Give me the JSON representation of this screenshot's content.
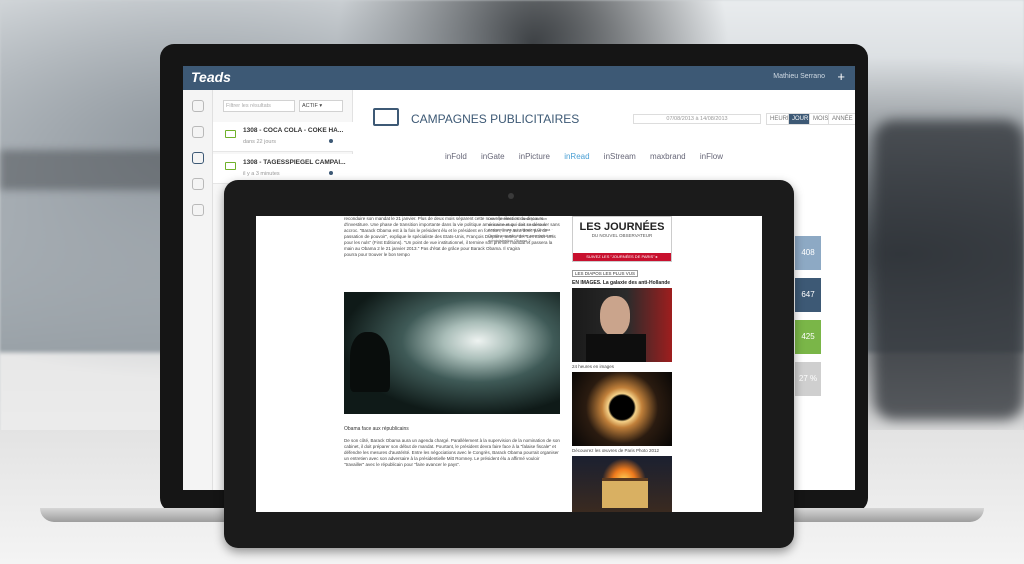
{
  "app": {
    "logo": "Teads",
    "user_name": "Mathieu Serrano",
    "add_symbol": "+"
  },
  "sidebar": {
    "search_placeholder": "Filtrer les résultats",
    "status_filter": "ACTIF ▾",
    "items": [
      {
        "title": "1308 - COCA COLA - COKE HA...",
        "subtitle": "dans 22 jours"
      },
      {
        "title": "1308 - TAGESSPIEGEL CAMPAI...",
        "subtitle": "il y a 3 minutes"
      }
    ]
  },
  "main": {
    "title": "CAMPAGNES PUBLICITAIRES",
    "date_range": "07/08/2013 à 14/08/2013",
    "periods": [
      "HEURE",
      "JOUR",
      "MOIS",
      "ANNÉE"
    ],
    "active_period": "JOUR",
    "formats": [
      "inFold",
      "inGate",
      "inPicture",
      "inRead",
      "inStream",
      "maxbrand",
      "inFlow"
    ],
    "active_format": "inRead",
    "cards": [
      {
        "value": "408",
        "color": "#8da9c4"
      },
      {
        "value": "647",
        "color": "#3d5975"
      },
      {
        "value": "425",
        "color": "#7ab648"
      },
      {
        "value": "27 %",
        "color": "#cfcfcf"
      }
    ]
  },
  "tablet_article": {
    "intro": "pourra pour trouver le bon tempo",
    "body_top": "reconduire son mandat le 21 janvier. Plus de deux mois séparent cette nouvelle élection du discours d'investiture. Une phase de transition importante dans la vie politique américaine et qui doit se dérouler sans accroc. \"Barack Obama est à la fois le président élu et le président en fonction, il n'y aura donc pas de passation de pouvoir\", explique le spécialiste des Etats-Unis, François Durpaire, auteur de \"Les Etats-Unis pour les nuls\" (First Editions). \"Un point de vue institutionnel, il termine son premier mandat et passera la main au Obama 2 le 21 janvier 2013.\" Pas d'état de grâce pour Barack Obama. Il s'agira",
    "photo_caption": "Obama face aux républicains",
    "body_bottom": "De son côté, Barack Obama aura un agenda chargé. Parallèlement à la supervision de la nomination de son cabinet, il doit préparer son début de mandat. Pourtant, le président devra faire face à la \"falaise fiscale\" et défendre les mesures d'austérité. Entre les négociations avec le Congrès, Barack Obama pourrait organiser un entretien avec son adversaire à la présidentielle Mitt Romney. Le président élu a affirmé vouloir \"travailler\" avec le républicain pour \"faire avancer le pays\".",
    "side_links": "Les 8 priorités d'Obama pour son second mandat · Les 4 chantiers économiques qui attendent Obama · Quelle nouvelle équipe pour la future administration Obama ?",
    "promo_title": "LES JOURNÉES",
    "promo_sub": "DU NOUVEL OBSERVATEUR",
    "promo_cta": "SUIVEZ LES \"JOURNÉES DE PARIS\" ▸",
    "diapos_tag": "LES DIAPOS LES PLUS VUS",
    "diapo_headline": "EN IMAGES. La galaxie des anti-Hollande",
    "caption_1": "24 heures en images",
    "caption_2": "Découvrez les œuvres de Paris Photo 2012"
  }
}
